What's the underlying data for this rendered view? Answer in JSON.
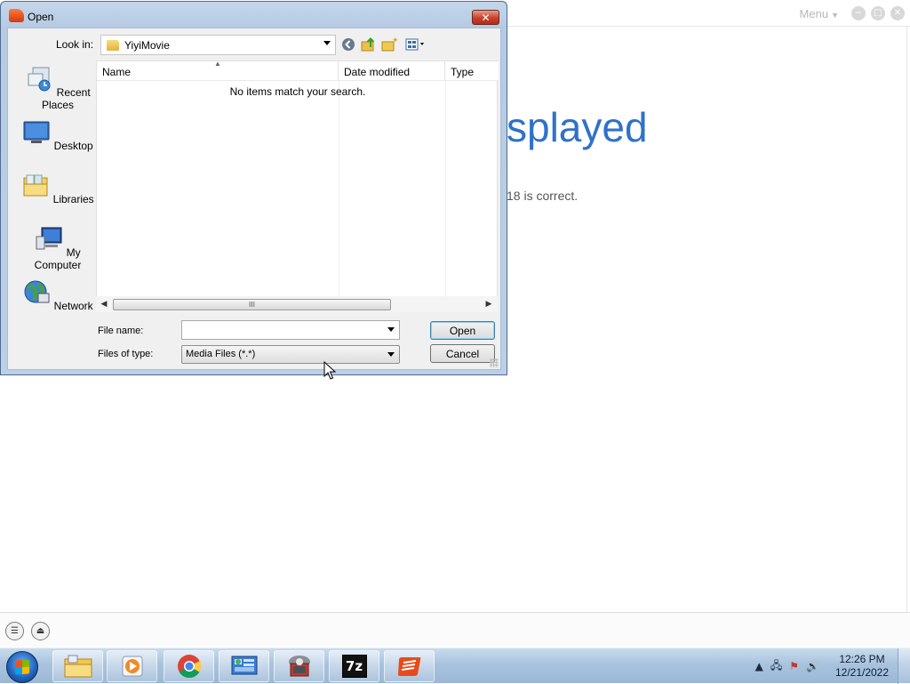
{
  "app": {
    "menu_label": "Menu",
    "error_title_fragment": "splayed",
    "error_desc_fragment": "18 is correct."
  },
  "dialog": {
    "title": "Open",
    "close_glyph": "✕",
    "look_in_label": "Look in:",
    "look_in_value": "YiyiMovie",
    "places": [
      {
        "label": "Recent Places",
        "icon": "recent-places-icon"
      },
      {
        "label": "Desktop",
        "icon": "desktop-icon"
      },
      {
        "label": "Libraries",
        "icon": "libraries-icon"
      },
      {
        "label": "My Computer",
        "icon": "computer-icon"
      },
      {
        "label": "Network",
        "icon": "network-icon"
      }
    ],
    "columns": [
      "Name",
      "Date modified",
      "Type"
    ],
    "empty_message": "No items match your search.",
    "file_name_label": "File name:",
    "file_name_value": "",
    "files_of_type_label": "Files of type:",
    "files_of_type_value": "Media Files (*.*)",
    "open_button": "Open",
    "cancel_button": "Cancel",
    "scroll_thumb_glyph": "III"
  },
  "taskbar": {
    "apps": [
      {
        "name": "file-explorer",
        "icon": "folder-icon"
      },
      {
        "name": "media-player",
        "icon": "video-icon"
      },
      {
        "name": "chrome",
        "icon": "chrome-icon"
      },
      {
        "name": "control-panel",
        "icon": "control-panel-icon"
      },
      {
        "name": "backup-tool",
        "icon": "installer-icon"
      },
      {
        "name": "7zip",
        "icon": "7zip-icon",
        "label": "7z"
      },
      {
        "name": "yiyi-player",
        "icon": "yiyi-icon"
      }
    ],
    "time": "12:26 PM",
    "date": "12/21/2022"
  }
}
